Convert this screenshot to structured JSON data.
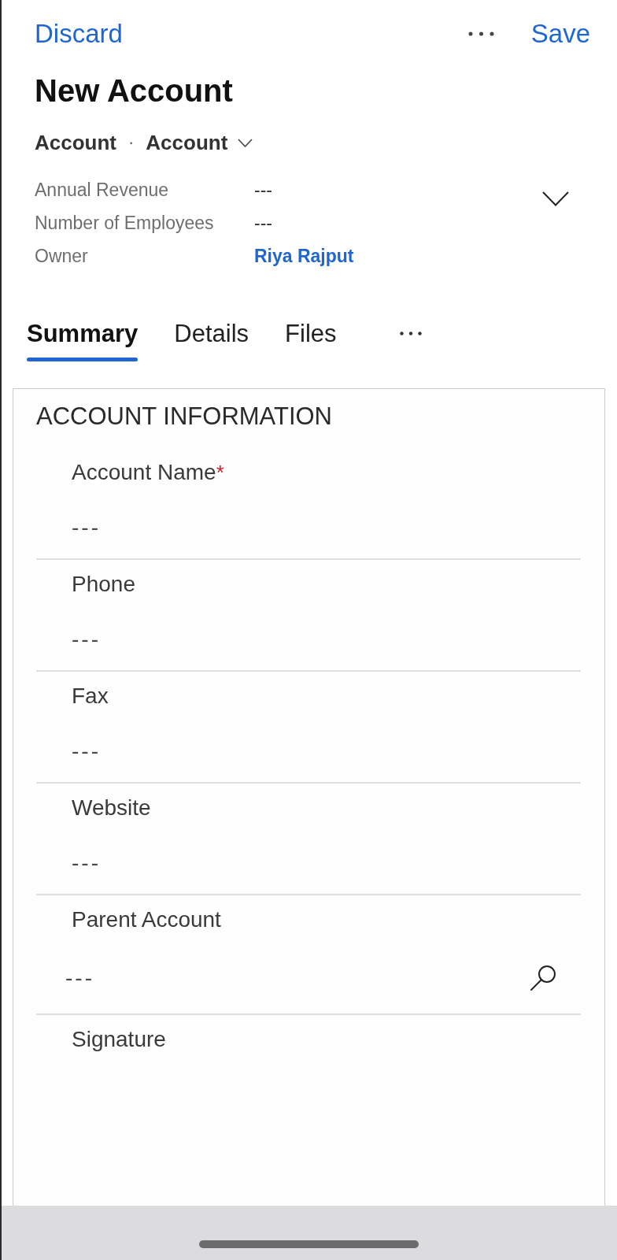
{
  "top_bar": {
    "discard": "Discard",
    "save": "Save"
  },
  "record": {
    "title": "New Account",
    "entity": "Account",
    "separator": "·",
    "form": "Account"
  },
  "header_fields": [
    {
      "label": "Annual Revenue",
      "value": "---",
      "kind": "text"
    },
    {
      "label": "Number of Employees",
      "value": "---",
      "kind": "text"
    },
    {
      "label": "Owner",
      "value": "Riya Rajput",
      "kind": "link"
    }
  ],
  "header_expanded": false,
  "tabs": [
    {
      "label": "Summary",
      "selected": true
    },
    {
      "label": "Details",
      "selected": false
    },
    {
      "label": "Files",
      "selected": false
    }
  ],
  "section": {
    "title": "ACCOUNT INFORMATION",
    "required_mark": "*",
    "fields": [
      {
        "label": "Account Name",
        "required": true,
        "placeholder": "---",
        "kind": "text"
      },
      {
        "label": "Phone",
        "required": false,
        "placeholder": "---",
        "kind": "text"
      },
      {
        "label": "Fax",
        "required": false,
        "placeholder": "---",
        "kind": "text"
      },
      {
        "label": "Website",
        "required": false,
        "placeholder": "---",
        "kind": "text"
      },
      {
        "label": "Parent Account",
        "required": false,
        "placeholder": "---",
        "kind": "lookup"
      },
      {
        "label": "Signature",
        "required": false,
        "kind": "signature"
      }
    ]
  }
}
